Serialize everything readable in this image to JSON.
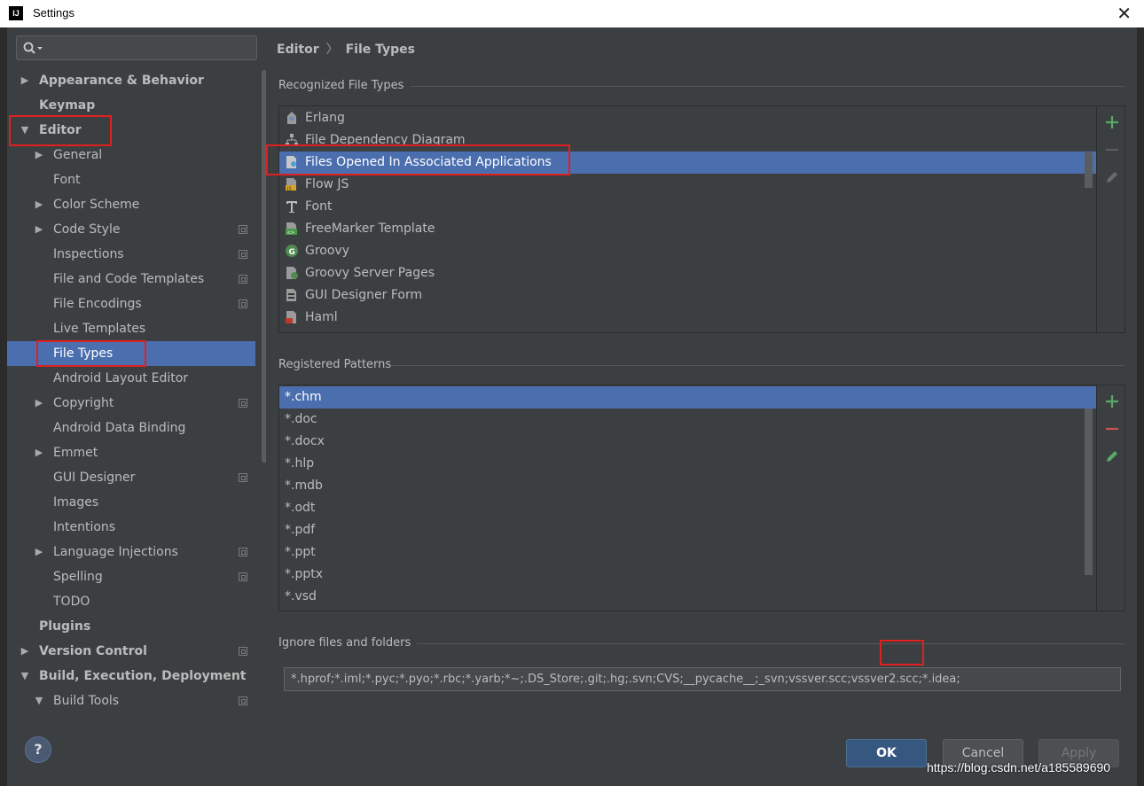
{
  "window": {
    "title": "Settings",
    "app_icon_text": "IJ"
  },
  "search": {
    "placeholder": ""
  },
  "tree": {
    "items": [
      {
        "label": "Appearance & Behavior"
      },
      {
        "label": "Keymap"
      },
      {
        "label": "Editor"
      },
      {
        "label": "General"
      },
      {
        "label": "Font"
      },
      {
        "label": "Color Scheme"
      },
      {
        "label": "Code Style"
      },
      {
        "label": "Inspections"
      },
      {
        "label": "File and Code Templates"
      },
      {
        "label": "File Encodings"
      },
      {
        "label": "Live Templates"
      },
      {
        "label": "File Types"
      },
      {
        "label": "Android Layout Editor"
      },
      {
        "label": "Copyright"
      },
      {
        "label": "Android Data Binding"
      },
      {
        "label": "Emmet"
      },
      {
        "label": "GUI Designer"
      },
      {
        "label": "Images"
      },
      {
        "label": "Intentions"
      },
      {
        "label": "Language Injections"
      },
      {
        "label": "Spelling"
      },
      {
        "label": "TODO"
      },
      {
        "label": "Plugins"
      },
      {
        "label": "Version Control"
      },
      {
        "label": "Build, Execution, Deployment"
      },
      {
        "label": "Build Tools"
      }
    ]
  },
  "breadcrumb": {
    "parent": "Editor",
    "separator": "〉",
    "current": "File Types"
  },
  "recognized": {
    "title": "Recognized File Types",
    "items": [
      {
        "label": "Erlang",
        "icon": "erlang-icon"
      },
      {
        "label": "File Dependency Diagram",
        "icon": "diagram-icon"
      },
      {
        "label": "Files Opened In Associated Applications",
        "icon": "associated-app-icon"
      },
      {
        "label": "Flow JS",
        "icon": "js-icon"
      },
      {
        "label": "Font",
        "icon": "font-icon"
      },
      {
        "label": "FreeMarker Template",
        "icon": "freemarker-icon"
      },
      {
        "label": "Groovy",
        "icon": "groovy-icon"
      },
      {
        "label": "Groovy Server Pages",
        "icon": "gsp-icon"
      },
      {
        "label": "GUI Designer Form",
        "icon": "form-icon"
      },
      {
        "label": "Haml",
        "icon": "haml-icon"
      }
    ],
    "selected": "Files Opened In Associated Applications"
  },
  "patterns": {
    "title": "Registered Patterns",
    "items": [
      "*.chm",
      "*.doc",
      "*.docx",
      "*.hlp",
      "*.mdb",
      "*.odt",
      "*.pdf",
      "*.ppt",
      "*.pptx",
      "*.vsd"
    ],
    "selected": "*.chm"
  },
  "ignore": {
    "title": "Ignore files and folders",
    "value": "*.hprof;*.iml;*.pyc;*.pyo;*.rbc;*.yarb;*~;.DS_Store;.git;.hg;.svn;CVS;__pycache__;_svn;vssver.scc;vssver2.scc;*.idea;"
  },
  "footer": {
    "help": "?",
    "ok": "OK",
    "cancel": "Cancel",
    "apply": "Apply"
  },
  "watermark": "https://blog.csdn.net/a185589690",
  "colors": {
    "background": "#3c3f41",
    "selection": "#4b6eaf",
    "annotation_red": "#e02020",
    "add_green": "#59a869",
    "remove_red": "#c75450"
  }
}
